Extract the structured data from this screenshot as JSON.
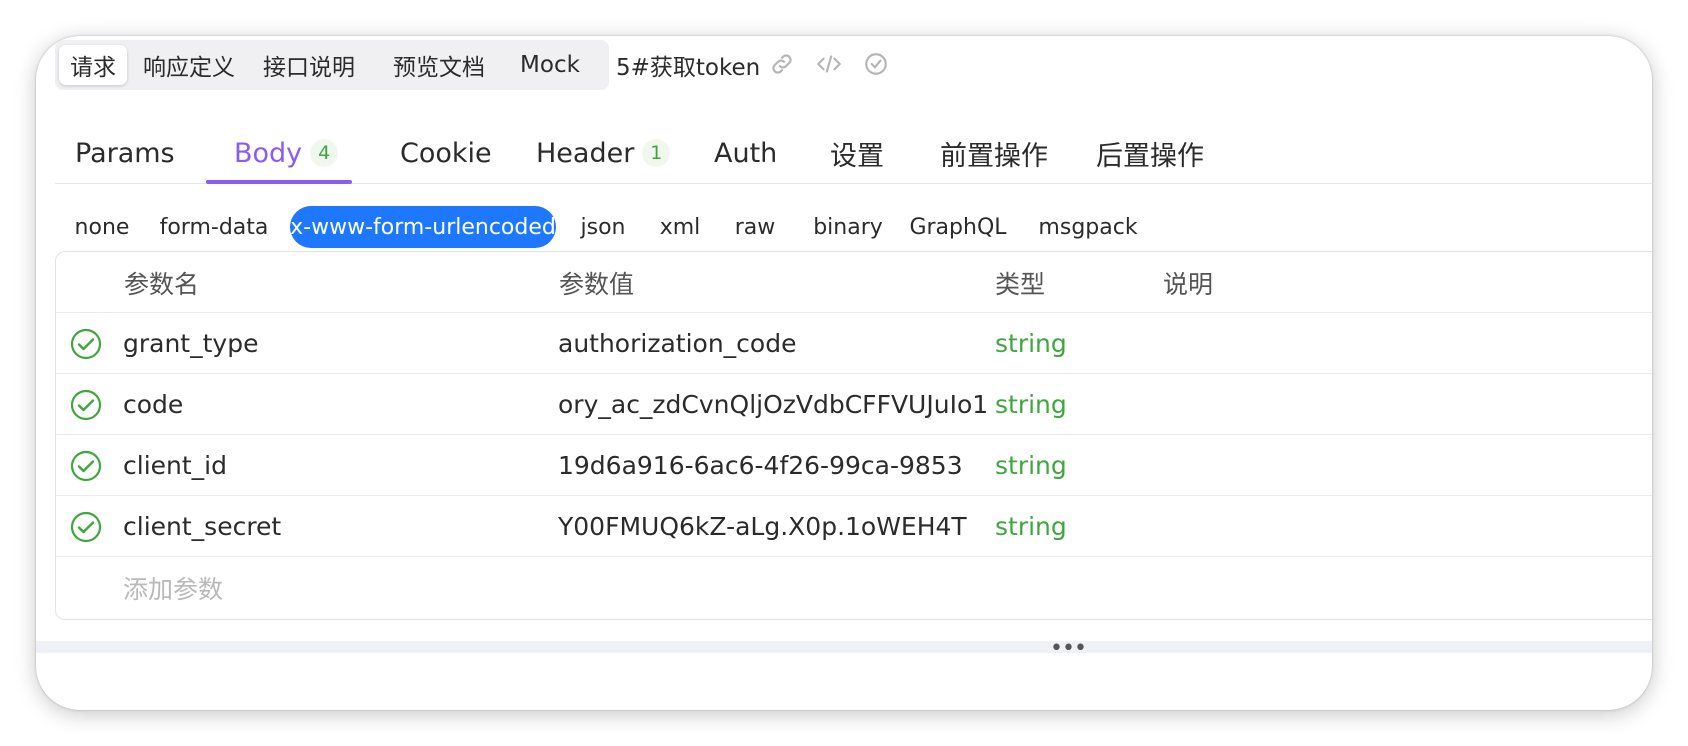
{
  "top_tabs": [
    "请求",
    "响应定义",
    "接口说明",
    "预览文档",
    "Mock"
  ],
  "api_title": "5#获取token",
  "top_icons": [
    "link-icon",
    "code-icon",
    "share-icon"
  ],
  "main_tabs": [
    {
      "label": "Params",
      "badge": ""
    },
    {
      "label": "Body",
      "badge": "4"
    },
    {
      "label": "Cookie",
      "badge": ""
    },
    {
      "label": "Header",
      "badge": "1"
    },
    {
      "label": "Auth",
      "badge": ""
    },
    {
      "label": "设置",
      "badge": ""
    },
    {
      "label": "前置操作",
      "badge": ""
    },
    {
      "label": "后置操作",
      "badge": ""
    }
  ],
  "body_types": [
    "none",
    "form-data",
    "x-www-form-urlencoded",
    "json",
    "xml",
    "raw",
    "binary",
    "GraphQL",
    "msgpack"
  ],
  "selected_body_type": "x-www-form-urlencoded",
  "table": {
    "headers": {
      "name": "参数名",
      "value": "参数值",
      "type": "类型",
      "desc": "说明"
    },
    "rows": [
      {
        "name": "grant_type",
        "value": "authorization_code",
        "type": "string",
        "desc": "",
        "enabled": true
      },
      {
        "name": "code",
        "value": "ory_ac_zdCvnQljOzVdbCFFVUJuIo1",
        "type": "string",
        "desc": "",
        "enabled": true
      },
      {
        "name": "client_id",
        "value": "19d6a916-6ac6-4f26-99ca-9853",
        "type": "string",
        "desc": "",
        "enabled": true
      },
      {
        "name": "client_secret",
        "value": "Y00FMUQ6kZ-aLg.X0p.1oWEH4T",
        "type": "string",
        "desc": "",
        "enabled": true
      }
    ],
    "add_placeholder": "添加参数"
  },
  "colors": {
    "accent": "#8a5cf5",
    "primary": "#1d77ff",
    "success": "#3ea83e"
  }
}
